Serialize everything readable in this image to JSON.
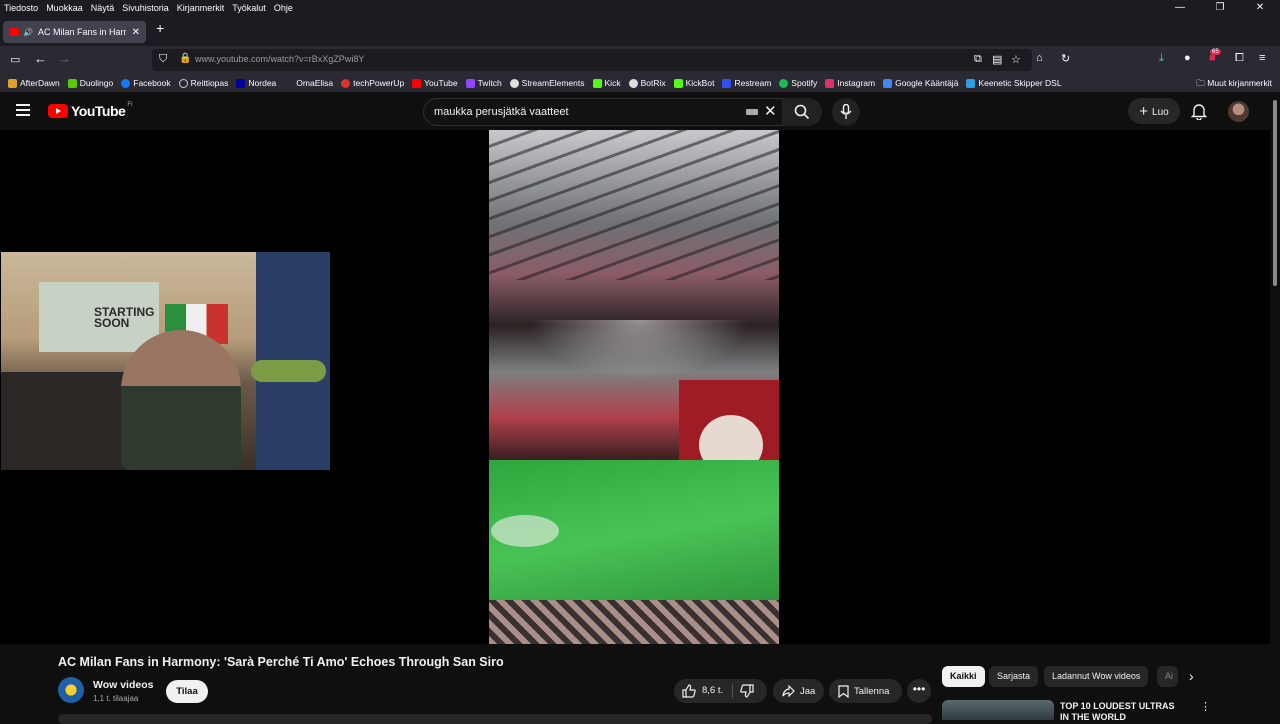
{
  "menubar": {
    "items": [
      "Tiedosto",
      "Muokkaa",
      "Näytä",
      "Sivuhistoria",
      "Kirjanmerkit",
      "Työkalut",
      "Ohje"
    ]
  },
  "window_controls": {
    "minimize": "—",
    "restore": "❐",
    "close": "✕"
  },
  "tab": {
    "title": "AC Milan Fans in Harmony:",
    "audio_icon": "speaker-icon",
    "close": "✕"
  },
  "new_tab": "+",
  "address": {
    "url": "www.youtube.com/watch?v=rBxXgZPwi8Y"
  },
  "toolbar": {
    "extensions_badge": "65"
  },
  "bookmarks": {
    "items": [
      {
        "label": "AfterDawn",
        "color": "#e0a030"
      },
      {
        "label": "Duolingo",
        "color": "#58cc02"
      },
      {
        "label": "Facebook",
        "color": "#1877f2"
      },
      {
        "label": "Reittiopas",
        "color": "#cccccc"
      },
      {
        "label": "Nordea",
        "color": "#0000a0"
      },
      {
        "label": "OmaElisa",
        "color": "#2b2a33"
      },
      {
        "label": "techPowerUp",
        "color": "#e03030"
      },
      {
        "label": "YouTube",
        "color": "#ff0000"
      },
      {
        "label": "Twitch",
        "color": "#9146ff"
      },
      {
        "label": "StreamElements",
        "color": "#e0e0e0"
      },
      {
        "label": "Kick",
        "color": "#53fc18"
      },
      {
        "label": "BotRix",
        "color": "#dddddd"
      },
      {
        "label": "KickBot",
        "color": "#53fc18"
      },
      {
        "label": "Restream",
        "color": "#3050f0"
      },
      {
        "label": "Spotify",
        "color": "#1db954"
      },
      {
        "label": "Instagram",
        "color": "#e1306c"
      },
      {
        "label": "Google Kääntäjä",
        "color": "#4285f4"
      },
      {
        "label": "Keenetic Skipper DSL",
        "color": "#2aa0e0"
      }
    ],
    "other": "Muut kirjanmerkit"
  },
  "youtube": {
    "logo_text": "YouTube",
    "logo_region": "FI",
    "search_value": "maukka perusjätkä vaatteet",
    "create_label": "Luo",
    "colors": {
      "brand": "#ff0000",
      "background": "#0f0f0f",
      "button": "#272727"
    }
  },
  "webcam": {
    "poster_text": "STARTING SOON"
  },
  "video": {
    "title": "AC Milan Fans in Harmony: 'Sarà Perché Ti Amo' Echoes Through San Siro",
    "channel": "Wow videos",
    "subscribers": "1,1 t. tilaajaa",
    "subscribe_label": "Tilaa",
    "likes": "8,6 t.",
    "share_label": "Jaa",
    "save_label": "Tallenna",
    "more": "•••"
  },
  "chips": [
    "Kaikki",
    "Sarjasta",
    "Ladannut Wow videos",
    "Ai"
  ],
  "recommended": {
    "title": "TOP 10 LOUDEST ULTRAS IN THE WORLD"
  }
}
